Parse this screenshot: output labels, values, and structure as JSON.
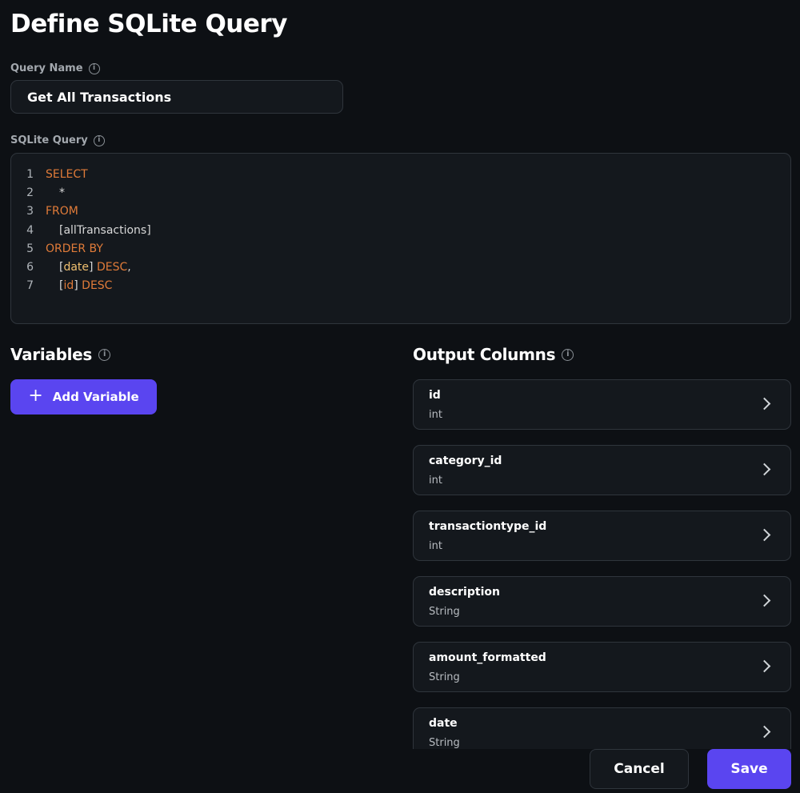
{
  "page": {
    "title": "Define SQLite Query"
  },
  "query_name": {
    "label": "Query Name",
    "value": "Get All Transactions"
  },
  "sql": {
    "label": "SQLite Query",
    "lines": [
      {
        "num": "1",
        "parts": [
          {
            "text": "SELECT",
            "kind": "kw"
          }
        ]
      },
      {
        "num": "2",
        "parts": [
          {
            "text": "*",
            "kind": "id",
            "indent": true
          }
        ]
      },
      {
        "num": "3",
        "parts": [
          {
            "text": "FROM",
            "kind": "kw"
          }
        ]
      },
      {
        "num": "4",
        "parts": [
          {
            "text": "[allTransactions]",
            "kind": "id",
            "indent": true
          }
        ]
      },
      {
        "num": "5",
        "parts": [
          {
            "text": "ORDER BY",
            "kind": "kw"
          }
        ]
      },
      {
        "num": "6",
        "parts": [
          {
            "text": "[",
            "kind": "id",
            "indent": true
          },
          {
            "text": "date",
            "kind": "col-id"
          },
          {
            "text": "] ",
            "kind": "id"
          },
          {
            "text": "DESC",
            "kind": "kw"
          },
          {
            "text": ",",
            "kind": "id"
          }
        ]
      },
      {
        "num": "7",
        "parts": [
          {
            "text": "[",
            "kind": "id",
            "indent": true
          },
          {
            "text": "id",
            "kind": "kw"
          },
          {
            "text": "] ",
            "kind": "id"
          },
          {
            "text": "DESC",
            "kind": "kw"
          }
        ]
      }
    ]
  },
  "variables": {
    "title": "Variables",
    "add_label": "Add Variable"
  },
  "output_columns": {
    "title": "Output Columns",
    "items": [
      {
        "name": "id",
        "type": "int"
      },
      {
        "name": "category_id",
        "type": "int"
      },
      {
        "name": "transactiontype_id",
        "type": "int"
      },
      {
        "name": "description",
        "type": "String"
      },
      {
        "name": "amount_formatted",
        "type": "String"
      },
      {
        "name": "date",
        "type": "String"
      }
    ]
  },
  "footer": {
    "cancel_label": "Cancel",
    "save_label": "Save"
  },
  "colors": {
    "accent": "#5a45f0",
    "keyword": "#e07b39",
    "background": "#0d1014",
    "panel": "#14181d"
  }
}
